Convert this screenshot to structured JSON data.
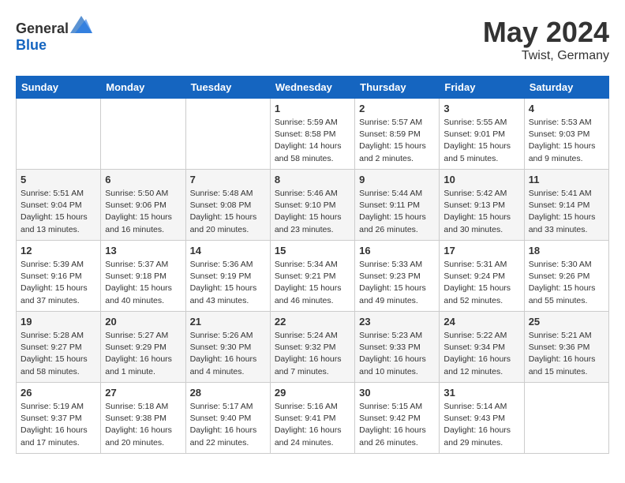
{
  "header": {
    "logo_general": "General",
    "logo_blue": "Blue",
    "month": "May 2024",
    "location": "Twist, Germany"
  },
  "days_of_week": [
    "Sunday",
    "Monday",
    "Tuesday",
    "Wednesday",
    "Thursday",
    "Friday",
    "Saturday"
  ],
  "weeks": [
    [
      {
        "day": "",
        "sunrise": "",
        "sunset": "",
        "daylight": ""
      },
      {
        "day": "",
        "sunrise": "",
        "sunset": "",
        "daylight": ""
      },
      {
        "day": "",
        "sunrise": "",
        "sunset": "",
        "daylight": ""
      },
      {
        "day": "1",
        "sunrise": "Sunrise: 5:59 AM",
        "sunset": "Sunset: 8:58 PM",
        "daylight": "Daylight: 14 hours and 58 minutes."
      },
      {
        "day": "2",
        "sunrise": "Sunrise: 5:57 AM",
        "sunset": "Sunset: 8:59 PM",
        "daylight": "Daylight: 15 hours and 2 minutes."
      },
      {
        "day": "3",
        "sunrise": "Sunrise: 5:55 AM",
        "sunset": "Sunset: 9:01 PM",
        "daylight": "Daylight: 15 hours and 5 minutes."
      },
      {
        "day": "4",
        "sunrise": "Sunrise: 5:53 AM",
        "sunset": "Sunset: 9:03 PM",
        "daylight": "Daylight: 15 hours and 9 minutes."
      }
    ],
    [
      {
        "day": "5",
        "sunrise": "Sunrise: 5:51 AM",
        "sunset": "Sunset: 9:04 PM",
        "daylight": "Daylight: 15 hours and 13 minutes."
      },
      {
        "day": "6",
        "sunrise": "Sunrise: 5:50 AM",
        "sunset": "Sunset: 9:06 PM",
        "daylight": "Daylight: 15 hours and 16 minutes."
      },
      {
        "day": "7",
        "sunrise": "Sunrise: 5:48 AM",
        "sunset": "Sunset: 9:08 PM",
        "daylight": "Daylight: 15 hours and 20 minutes."
      },
      {
        "day": "8",
        "sunrise": "Sunrise: 5:46 AM",
        "sunset": "Sunset: 9:10 PM",
        "daylight": "Daylight: 15 hours and 23 minutes."
      },
      {
        "day": "9",
        "sunrise": "Sunrise: 5:44 AM",
        "sunset": "Sunset: 9:11 PM",
        "daylight": "Daylight: 15 hours and 26 minutes."
      },
      {
        "day": "10",
        "sunrise": "Sunrise: 5:42 AM",
        "sunset": "Sunset: 9:13 PM",
        "daylight": "Daylight: 15 hours and 30 minutes."
      },
      {
        "day": "11",
        "sunrise": "Sunrise: 5:41 AM",
        "sunset": "Sunset: 9:14 PM",
        "daylight": "Daylight: 15 hours and 33 minutes."
      }
    ],
    [
      {
        "day": "12",
        "sunrise": "Sunrise: 5:39 AM",
        "sunset": "Sunset: 9:16 PM",
        "daylight": "Daylight: 15 hours and 37 minutes."
      },
      {
        "day": "13",
        "sunrise": "Sunrise: 5:37 AM",
        "sunset": "Sunset: 9:18 PM",
        "daylight": "Daylight: 15 hours and 40 minutes."
      },
      {
        "day": "14",
        "sunrise": "Sunrise: 5:36 AM",
        "sunset": "Sunset: 9:19 PM",
        "daylight": "Daylight: 15 hours and 43 minutes."
      },
      {
        "day": "15",
        "sunrise": "Sunrise: 5:34 AM",
        "sunset": "Sunset: 9:21 PM",
        "daylight": "Daylight: 15 hours and 46 minutes."
      },
      {
        "day": "16",
        "sunrise": "Sunrise: 5:33 AM",
        "sunset": "Sunset: 9:23 PM",
        "daylight": "Daylight: 15 hours and 49 minutes."
      },
      {
        "day": "17",
        "sunrise": "Sunrise: 5:31 AM",
        "sunset": "Sunset: 9:24 PM",
        "daylight": "Daylight: 15 hours and 52 minutes."
      },
      {
        "day": "18",
        "sunrise": "Sunrise: 5:30 AM",
        "sunset": "Sunset: 9:26 PM",
        "daylight": "Daylight: 15 hours and 55 minutes."
      }
    ],
    [
      {
        "day": "19",
        "sunrise": "Sunrise: 5:28 AM",
        "sunset": "Sunset: 9:27 PM",
        "daylight": "Daylight: 15 hours and 58 minutes."
      },
      {
        "day": "20",
        "sunrise": "Sunrise: 5:27 AM",
        "sunset": "Sunset: 9:29 PM",
        "daylight": "Daylight: 16 hours and 1 minute."
      },
      {
        "day": "21",
        "sunrise": "Sunrise: 5:26 AM",
        "sunset": "Sunset: 9:30 PM",
        "daylight": "Daylight: 16 hours and 4 minutes."
      },
      {
        "day": "22",
        "sunrise": "Sunrise: 5:24 AM",
        "sunset": "Sunset: 9:32 PM",
        "daylight": "Daylight: 16 hours and 7 minutes."
      },
      {
        "day": "23",
        "sunrise": "Sunrise: 5:23 AM",
        "sunset": "Sunset: 9:33 PM",
        "daylight": "Daylight: 16 hours and 10 minutes."
      },
      {
        "day": "24",
        "sunrise": "Sunrise: 5:22 AM",
        "sunset": "Sunset: 9:34 PM",
        "daylight": "Daylight: 16 hours and 12 minutes."
      },
      {
        "day": "25",
        "sunrise": "Sunrise: 5:21 AM",
        "sunset": "Sunset: 9:36 PM",
        "daylight": "Daylight: 16 hours and 15 minutes."
      }
    ],
    [
      {
        "day": "26",
        "sunrise": "Sunrise: 5:19 AM",
        "sunset": "Sunset: 9:37 PM",
        "daylight": "Daylight: 16 hours and 17 minutes."
      },
      {
        "day": "27",
        "sunrise": "Sunrise: 5:18 AM",
        "sunset": "Sunset: 9:38 PM",
        "daylight": "Daylight: 16 hours and 20 minutes."
      },
      {
        "day": "28",
        "sunrise": "Sunrise: 5:17 AM",
        "sunset": "Sunset: 9:40 PM",
        "daylight": "Daylight: 16 hours and 22 minutes."
      },
      {
        "day": "29",
        "sunrise": "Sunrise: 5:16 AM",
        "sunset": "Sunset: 9:41 PM",
        "daylight": "Daylight: 16 hours and 24 minutes."
      },
      {
        "day": "30",
        "sunrise": "Sunrise: 5:15 AM",
        "sunset": "Sunset: 9:42 PM",
        "daylight": "Daylight: 16 hours and 26 minutes."
      },
      {
        "day": "31",
        "sunrise": "Sunrise: 5:14 AM",
        "sunset": "Sunset: 9:43 PM",
        "daylight": "Daylight: 16 hours and 29 minutes."
      },
      {
        "day": "",
        "sunrise": "",
        "sunset": "",
        "daylight": ""
      }
    ]
  ]
}
